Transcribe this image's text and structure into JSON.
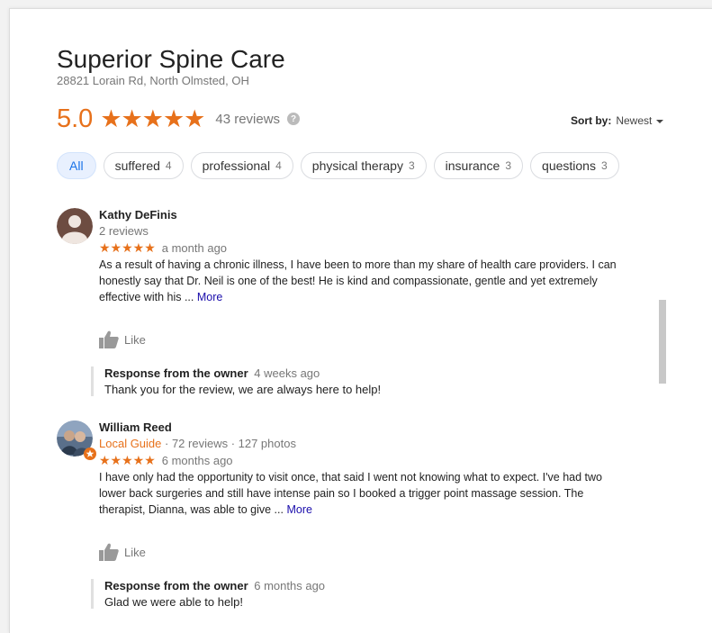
{
  "business": {
    "name": "Superior Spine Care",
    "address": "28821 Lorain Rd, North Olmsted, OH",
    "rating": "5.0",
    "stars": "★★★★★",
    "review_count": "43 reviews",
    "help_glyph": "?"
  },
  "sort": {
    "label": "Sort by:",
    "value": "Newest"
  },
  "filters": [
    {
      "label": "All",
      "count": "",
      "active": true
    },
    {
      "label": "suffered",
      "count": "4"
    },
    {
      "label": "professional",
      "count": "4"
    },
    {
      "label": "physical therapy",
      "count": "3"
    },
    {
      "label": "insurance",
      "count": "3"
    },
    {
      "label": "questions",
      "count": "3"
    }
  ],
  "reviews": [
    {
      "author": "Kathy DeFinis",
      "meta": "2 reviews",
      "stars": "★★★★★",
      "rating": 5,
      "when": "a month ago",
      "text": "As a result of having a chronic illness, I have been to more than my share of health care providers.   I can honestly say that Dr. Neil is one of the best!  He is kind and compassionate, gentle and yet extremely effective with his ...",
      "more": "More",
      "like": "Like",
      "response": {
        "title": "Response from the owner",
        "when": "4 weeks ago",
        "text": "Thank you for the review, we are always here to help!"
      }
    },
    {
      "author": "William Reed",
      "guide": "Local Guide",
      "meta": " · 72 reviews · 127 photos",
      "stars": "★★★★★",
      "rating": 5,
      "when": "6 months ago",
      "text": "I have only had the opportunity to visit once, that said I went not knowing what to expect. I've had two lower back surgeries and still have intense pain so I booked a trigger point massage session. The therapist, Dianna, was able to give ...",
      "more": "More",
      "like": "Like",
      "response": {
        "title": "Response from the owner",
        "when": "6 months ago",
        "text": "Glad we were able to help!"
      }
    }
  ],
  "colors": {
    "accent": "#e7711b",
    "link": "#1a0dab",
    "chip_active_bg": "#e8f0fe",
    "chip_active_text": "#1a73e8"
  }
}
